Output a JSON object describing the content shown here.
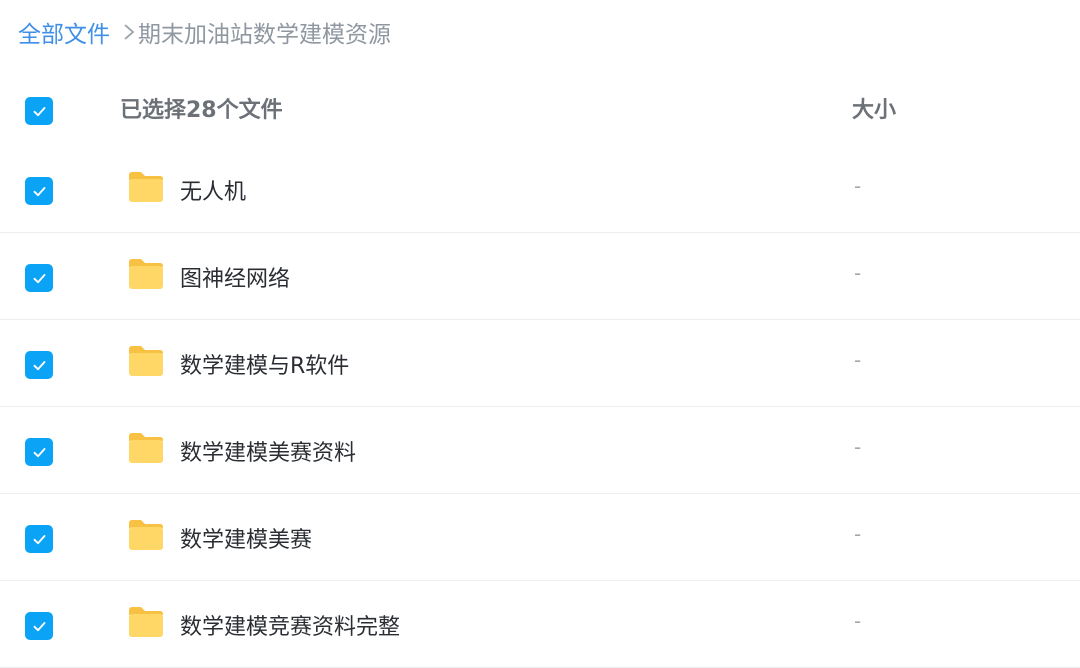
{
  "breadcrumb": {
    "root": "全部文件",
    "current": "期末加油站数学建模资源"
  },
  "header": {
    "selected_label": "已选择28个文件",
    "size_label": "大小"
  },
  "files": [
    {
      "name": "无人机",
      "size": "-",
      "checked": true,
      "icon": "folder-icon"
    },
    {
      "name": "图神经网络",
      "size": "-",
      "checked": true,
      "icon": "folder-icon"
    },
    {
      "name": "数学建模与R软件",
      "size": "-",
      "checked": true,
      "icon": "folder-icon"
    },
    {
      "name": "数学建模美赛资料",
      "size": "-",
      "checked": true,
      "icon": "folder-icon"
    },
    {
      "name": "数学建模美赛",
      "size": "-",
      "checked": true,
      "icon": "folder-icon"
    },
    {
      "name": "数学建模竞赛资料完整",
      "size": "-",
      "checked": true,
      "icon": "folder-icon"
    }
  ],
  "colors": {
    "accent": "#3f8fe8",
    "checkbox": "#0aa3f5",
    "folder": "#ffd15c"
  }
}
